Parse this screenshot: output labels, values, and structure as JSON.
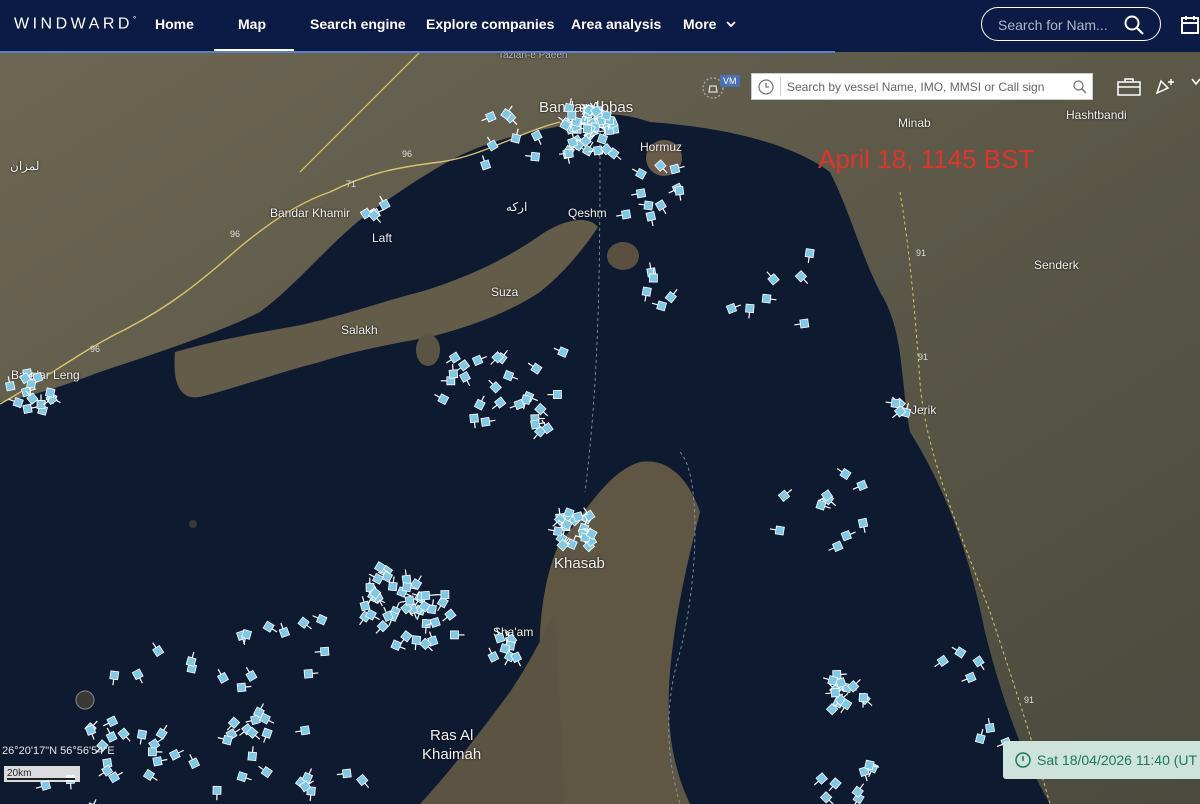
{
  "nav": {
    "logo": "WINDWARD",
    "logo_mark": "°",
    "items": [
      {
        "label": "Home"
      },
      {
        "label": "Map",
        "active": true
      },
      {
        "label": "Search engine"
      },
      {
        "label": "Explore companies"
      },
      {
        "label": "Area analysis"
      },
      {
        "label": "More"
      }
    ],
    "search_placeholder": "Search for Nam...",
    "accent_color": "#0c1b45"
  },
  "map": {
    "vessel_search_placeholder": "Search by vessel Name, IMO, MMSI or Call sign",
    "vm_badge": "VM",
    "date_overlay": "April 18, 1145 BST",
    "timestamp": "Sat 18/04/2026 11:40 (UT",
    "coordinates": "26°20'17\"N 56°56'54\"E",
    "scale_label": "20km",
    "places": {
      "bandar_abbas": "Bandar Abbas",
      "hormuz": "Hormuz",
      "minab": "Minab",
      "hashtbandi": "Hashtbandi",
      "bandar_khamir": "Bandar Khamir",
      "laft": "Laft",
      "qeshm": "Qeshm",
      "qeshm_fa": "ارکه",
      "suza": "Suza",
      "salakh": "Salakh",
      "senderk": "Senderk",
      "bandar_lengeh": "Bandar Leng",
      "jask": "Jerik",
      "khasab": "Khasab",
      "sham": "Sha'am",
      "ras_al_khaimah_1": "Ras Al",
      "ras_al_khaimah_2": "Khaimah",
      "persian_fa": "لمزان",
      "tazian": "Tazian-e Paeen"
    },
    "road_numbers": [
      "96",
      "71",
      "96",
      "96",
      "91",
      "91",
      "91"
    ],
    "vessel_color": "#7fc8e6",
    "icons": {
      "nav_search": "search-icon",
      "calendar": "calendar-icon",
      "clock": "clock-icon",
      "vessel_search": "search-icon",
      "vessel_monitor": "vessel-monitor-icon",
      "toolbox": "toolbox-icon",
      "alert": "bell-add-icon",
      "time": "timer-icon"
    }
  }
}
